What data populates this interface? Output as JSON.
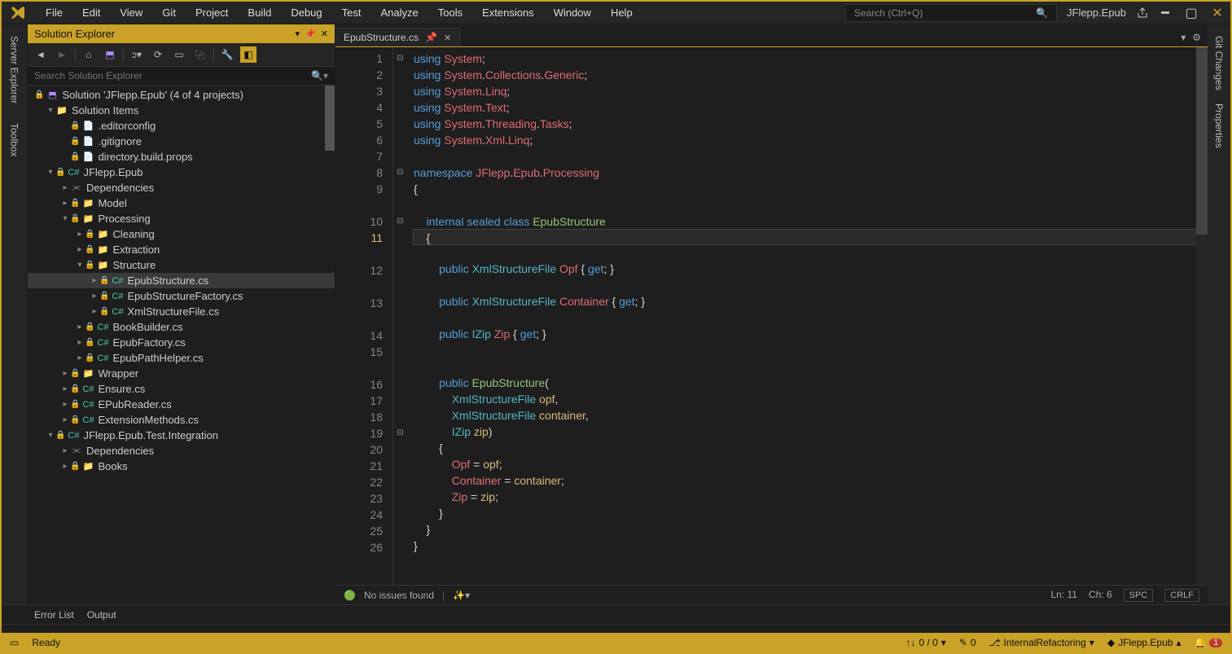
{
  "menu": [
    "File",
    "Edit",
    "View",
    "Git",
    "Project",
    "Build",
    "Debug",
    "Test",
    "Analyze",
    "Tools",
    "Extensions",
    "Window",
    "Help"
  ],
  "search_placeholder": "Search (Ctrl+Q)",
  "project_name": "JFlepp.Epub",
  "solution_explorer": {
    "title": "Solution Explorer",
    "search_placeholder": "Search Solution Explorer",
    "root": "Solution 'JFlepp.Epub' (4 of 4 projects)",
    "items": [
      {
        "depth": 1,
        "caret": "▾",
        "icon": "folder",
        "label": "Solution Items",
        "lock": false
      },
      {
        "depth": 2,
        "caret": "",
        "icon": "file",
        "label": ".editorconfig",
        "lock": true
      },
      {
        "depth": 2,
        "caret": "",
        "icon": "file",
        "label": ".gitignore",
        "lock": true
      },
      {
        "depth": 2,
        "caret": "",
        "icon": "file",
        "label": "directory.build.props",
        "lock": true
      },
      {
        "depth": 1,
        "caret": "▾",
        "icon": "csproj",
        "label": "JFlepp.Epub",
        "lock": true
      },
      {
        "depth": 2,
        "caret": "▸",
        "icon": "ref",
        "label": "Dependencies",
        "lock": false
      },
      {
        "depth": 2,
        "caret": "▸",
        "icon": "folder",
        "label": "Model",
        "lock": true
      },
      {
        "depth": 2,
        "caret": "▾",
        "icon": "folder",
        "label": "Processing",
        "lock": true
      },
      {
        "depth": 3,
        "caret": "▸",
        "icon": "folder",
        "label": "Cleaning",
        "lock": true
      },
      {
        "depth": 3,
        "caret": "▸",
        "icon": "folder",
        "label": "Extraction",
        "lock": true
      },
      {
        "depth": 3,
        "caret": "▾",
        "icon": "folder",
        "label": "Structure",
        "lock": true
      },
      {
        "depth": 4,
        "caret": "▸",
        "icon": "cs",
        "label": "EpubStructure.cs",
        "lock": true,
        "selected": true
      },
      {
        "depth": 4,
        "caret": "▸",
        "icon": "cs",
        "label": "EpubStructureFactory.cs",
        "lock": true
      },
      {
        "depth": 4,
        "caret": "▸",
        "icon": "cs",
        "label": "XmlStructureFile.cs",
        "lock": true
      },
      {
        "depth": 3,
        "caret": "▸",
        "icon": "cs",
        "label": "BookBuilder.cs",
        "lock": true
      },
      {
        "depth": 3,
        "caret": "▸",
        "icon": "cs",
        "label": "EpubFactory.cs",
        "lock": true
      },
      {
        "depth": 3,
        "caret": "▸",
        "icon": "cs",
        "label": "EpubPathHelper.cs",
        "lock": true
      },
      {
        "depth": 2,
        "caret": "▸",
        "icon": "folder",
        "label": "Wrapper",
        "lock": true
      },
      {
        "depth": 2,
        "caret": "▸",
        "icon": "cs",
        "label": "Ensure.cs",
        "lock": true
      },
      {
        "depth": 2,
        "caret": "▸",
        "icon": "cs",
        "label": "EPubReader.cs",
        "lock": true
      },
      {
        "depth": 2,
        "caret": "▸",
        "icon": "cs",
        "label": "ExtensionMethods.cs",
        "lock": true
      },
      {
        "depth": 1,
        "caret": "▾",
        "icon": "csproj",
        "label": "JFlepp.Epub.Test.Integration",
        "lock": true
      },
      {
        "depth": 2,
        "caret": "▸",
        "icon": "ref",
        "label": "Dependencies",
        "lock": false
      },
      {
        "depth": 2,
        "caret": "▸",
        "icon": "folder",
        "label": "Books",
        "lock": true
      }
    ]
  },
  "editor": {
    "tab_name": "EpubStructure.cs",
    "lines": [
      {
        "n": 1,
        "fold": "⊟",
        "segs": [
          [
            "kw",
            "using "
          ],
          [
            "red",
            "System"
          ],
          [
            "op",
            ";"
          ]
        ]
      },
      {
        "n": 2,
        "fold": "",
        "segs": [
          [
            "kw",
            "using "
          ],
          [
            "red",
            "System"
          ],
          [
            "op",
            "."
          ],
          [
            "red",
            "Collections"
          ],
          [
            "op",
            "."
          ],
          [
            "red",
            "Generic"
          ],
          [
            "op",
            ";"
          ]
        ]
      },
      {
        "n": 3,
        "fold": "",
        "segs": [
          [
            "kw",
            "using "
          ],
          [
            "red",
            "System"
          ],
          [
            "op",
            "."
          ],
          [
            "red",
            "Linq"
          ],
          [
            "op",
            ";"
          ]
        ]
      },
      {
        "n": 4,
        "fold": "",
        "segs": [
          [
            "kw",
            "using "
          ],
          [
            "red",
            "System"
          ],
          [
            "op",
            "."
          ],
          [
            "red",
            "Text"
          ],
          [
            "op",
            ";"
          ]
        ]
      },
      {
        "n": 5,
        "fold": "",
        "segs": [
          [
            "kw",
            "using "
          ],
          [
            "red",
            "System"
          ],
          [
            "op",
            "."
          ],
          [
            "red",
            "Threading"
          ],
          [
            "op",
            "."
          ],
          [
            "red",
            "Tasks"
          ],
          [
            "op",
            ";"
          ]
        ]
      },
      {
        "n": 6,
        "fold": "",
        "segs": [
          [
            "kw",
            "using "
          ],
          [
            "red",
            "System"
          ],
          [
            "op",
            "."
          ],
          [
            "red",
            "Xml"
          ],
          [
            "op",
            "."
          ],
          [
            "red",
            "Linq"
          ],
          [
            "op",
            ";"
          ]
        ]
      },
      {
        "n": 7,
        "fold": "",
        "segs": []
      },
      {
        "n": 8,
        "fold": "⊟",
        "segs": [
          [
            "kw",
            "namespace "
          ],
          [
            "red",
            "JFlepp"
          ],
          [
            "op",
            "."
          ],
          [
            "red",
            "Epub"
          ],
          [
            "op",
            "."
          ],
          [
            "red",
            "Processing"
          ]
        ]
      },
      {
        "n": 9,
        "fold": "",
        "segs": [
          [
            "op",
            "{"
          ]
        ]
      },
      {
        "n": "",
        "fold": "",
        "segs": []
      },
      {
        "n": 10,
        "fold": "⊟",
        "segs": [
          [
            "op",
            "    "
          ],
          [
            "kw",
            "internal sealed class "
          ],
          [
            "green",
            "EpubStructure"
          ]
        ]
      },
      {
        "n": 11,
        "fold": "",
        "cur": true,
        "hl": true,
        "segs": [
          [
            "op",
            "    {"
          ]
        ]
      },
      {
        "n": "",
        "fold": "",
        "segs": []
      },
      {
        "n": 12,
        "fold": "",
        "segs": [
          [
            "op",
            "        "
          ],
          [
            "kw",
            "public "
          ],
          [
            "cyan",
            "XmlStructureFile"
          ],
          [
            "op",
            " "
          ],
          [
            "red",
            "Opf"
          ],
          [
            "op",
            " { "
          ],
          [
            "kw",
            "get"
          ],
          [
            "op",
            "; }"
          ]
        ]
      },
      {
        "n": "",
        "fold": "",
        "segs": []
      },
      {
        "n": 13,
        "fold": "",
        "segs": [
          [
            "op",
            "        "
          ],
          [
            "kw",
            "public "
          ],
          [
            "cyan",
            "XmlStructureFile"
          ],
          [
            "op",
            " "
          ],
          [
            "red",
            "Container"
          ],
          [
            "op",
            " { "
          ],
          [
            "kw",
            "get"
          ],
          [
            "op",
            "; }"
          ]
        ]
      },
      {
        "n": "",
        "fold": "",
        "segs": []
      },
      {
        "n": 14,
        "fold": "",
        "segs": [
          [
            "op",
            "        "
          ],
          [
            "kw",
            "public "
          ],
          [
            "cyan",
            "IZip"
          ],
          [
            "op",
            " "
          ],
          [
            "red",
            "Zip"
          ],
          [
            "op",
            " { "
          ],
          [
            "kw",
            "get"
          ],
          [
            "op",
            "; }"
          ]
        ]
      },
      {
        "n": 15,
        "fold": "",
        "segs": []
      },
      {
        "n": "",
        "fold": "",
        "segs": []
      },
      {
        "n": 16,
        "fold": "",
        "segs": [
          [
            "op",
            "        "
          ],
          [
            "kw",
            "public "
          ],
          [
            "green",
            "EpubStructure"
          ],
          [
            "op",
            "("
          ]
        ]
      },
      {
        "n": 17,
        "fold": "",
        "segs": [
          [
            "op",
            "            "
          ],
          [
            "cyan",
            "XmlStructureFile"
          ],
          [
            "op",
            " "
          ],
          [
            "yellow",
            "opf"
          ],
          [
            "op",
            ","
          ]
        ]
      },
      {
        "n": 18,
        "fold": "",
        "segs": [
          [
            "op",
            "            "
          ],
          [
            "cyan",
            "XmlStructureFile"
          ],
          [
            "op",
            " "
          ],
          [
            "yellow",
            "container"
          ],
          [
            "op",
            ","
          ]
        ]
      },
      {
        "n": 19,
        "fold": "⊟",
        "segs": [
          [
            "op",
            "            "
          ],
          [
            "cyan",
            "IZip"
          ],
          [
            "op",
            " "
          ],
          [
            "yellow",
            "zip"
          ],
          [
            "op",
            ")"
          ]
        ]
      },
      {
        "n": 20,
        "fold": "",
        "segs": [
          [
            "op",
            "        {"
          ]
        ]
      },
      {
        "n": 21,
        "fold": "",
        "segs": [
          [
            "op",
            "            "
          ],
          [
            "red",
            "Opf"
          ],
          [
            "op",
            " = "
          ],
          [
            "yellow",
            "opf"
          ],
          [
            "op",
            ";"
          ]
        ]
      },
      {
        "n": 22,
        "fold": "",
        "segs": [
          [
            "op",
            "            "
          ],
          [
            "red",
            "Container"
          ],
          [
            "op",
            " = "
          ],
          [
            "yellow",
            "container"
          ],
          [
            "op",
            ";"
          ]
        ]
      },
      {
        "n": 23,
        "fold": "",
        "segs": [
          [
            "op",
            "            "
          ],
          [
            "red",
            "Zip"
          ],
          [
            "op",
            " = "
          ],
          [
            "yellow",
            "zip"
          ],
          [
            "op",
            ";"
          ]
        ]
      },
      {
        "n": 24,
        "fold": "",
        "segs": [
          [
            "op",
            "        }"
          ]
        ]
      },
      {
        "n": 25,
        "fold": "",
        "segs": [
          [
            "op",
            "    }"
          ]
        ]
      },
      {
        "n": 26,
        "fold": "",
        "segs": [
          [
            "op",
            "}"
          ]
        ]
      }
    ],
    "status": {
      "issues": "No issues found",
      "ln": "Ln: 11",
      "ch": "Ch: 6",
      "ind": "SPC",
      "eol": "CRLF"
    }
  },
  "bottom_tabs": [
    "Error List",
    "Output"
  ],
  "statusbar": {
    "ready": "Ready",
    "updown": "0 / 0",
    "pencil": "0",
    "branch": "InternalRefactoring",
    "proj": "JFlepp.Epub",
    "notif": "1"
  },
  "right_tabs": [
    "Git Changes",
    "Properties"
  ]
}
